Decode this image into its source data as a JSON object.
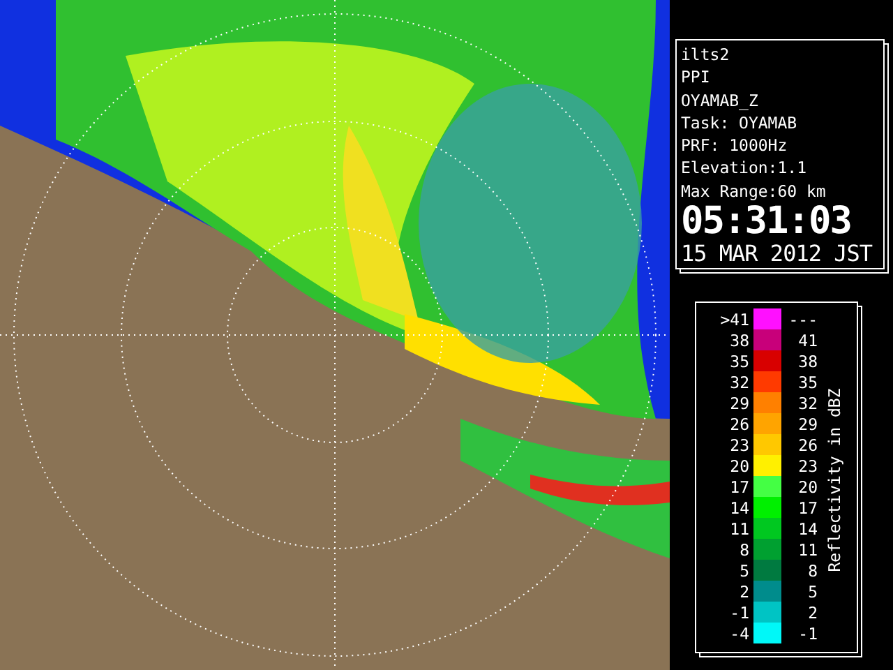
{
  "info": {
    "lines": [
      "ilts2",
      "PPI",
      "OYAMAB_Z",
      "Task: OYAMAB",
      "PRF: 1000Hz",
      "Elevation:1.1",
      "Max Range:60 km"
    ],
    "time": "05:31:03",
    "date": "15 MAR 2012 JST"
  },
  "legend": {
    "title": "Reflectivity in dBZ",
    "rows": [
      {
        "low": ">41",
        "high": "---",
        "color": "#ff10ff"
      },
      {
        "low": "38",
        "high": "41",
        "color": "#c8007a"
      },
      {
        "low": "35",
        "high": "38",
        "color": "#d80000"
      },
      {
        "low": "32",
        "high": "35",
        "color": "#ff3a00"
      },
      {
        "low": "29",
        "high": "32",
        "color": "#ff8000"
      },
      {
        "low": "26",
        "high": "29",
        "color": "#ffa400"
      },
      {
        "low": "23",
        "high": "26",
        "color": "#ffc800"
      },
      {
        "low": "20",
        "high": "23",
        "color": "#fff000"
      },
      {
        "low": "17",
        "high": "20",
        "color": "#44ff44"
      },
      {
        "low": "14",
        "high": "17",
        "color": "#00f000"
      },
      {
        "low": "11",
        "high": "14",
        "color": "#00c820"
      },
      {
        "low": "8",
        "high": "11",
        "color": "#00a030"
      },
      {
        "low": "5",
        "high": "8",
        "color": "#007a40"
      },
      {
        "low": "2",
        "high": "5",
        "color": "#008c8c"
      },
      {
        "low": "-1",
        "high": "2",
        "color": "#00c4c4"
      },
      {
        "low": "-4",
        "high": "-1",
        "color": "#00f8f8"
      }
    ]
  }
}
